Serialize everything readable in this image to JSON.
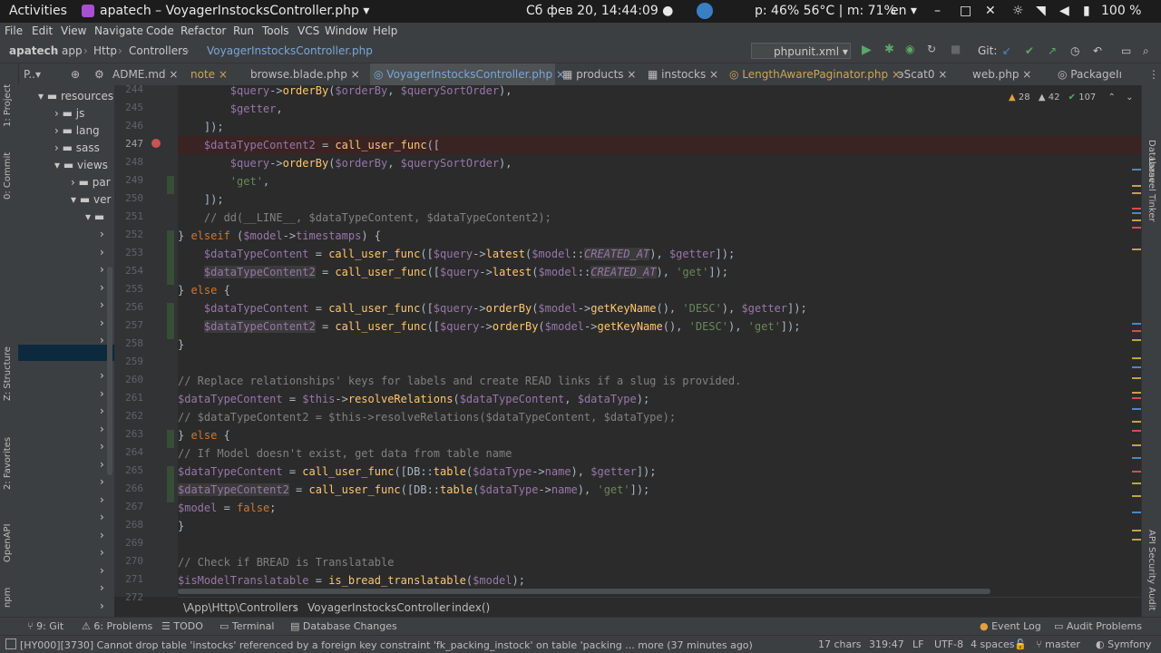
{
  "system_bar": {
    "activities": "Activities",
    "app_title": "apatech – VoyagerInstocksController.php ▾",
    "clock": "Сб фев 20, 14:44:09 ●",
    "cpu": "p: 46% 56°C | m: 71%",
    "lang": "en ▾",
    "battery": "100 %"
  },
  "menu": [
    "File",
    "Edit",
    "View",
    "Navigate",
    "Code",
    "Refactor",
    "Run",
    "Tools",
    "VCS",
    "Window",
    "Help"
  ],
  "nav": {
    "crumbs": [
      "apatech",
      "app",
      "Http",
      "Controllers",
      "VoyagerInstocksController.php"
    ],
    "run_config": "phpunit.xml",
    "git_label": "Git:"
  },
  "tabs": [
    {
      "label": "ADME.md"
    },
    {
      "label": "note"
    },
    {
      "label": "browse.blade.php"
    },
    {
      "label": "VoyagerInstocksController.php"
    },
    {
      "label": "products"
    },
    {
      "label": "instocks"
    },
    {
      "label": "LengthAwarePaginator.php"
    },
    {
      "label": "эScat0"
    },
    {
      "label": "web.php"
    },
    {
      "label": "PackageIı"
    }
  ],
  "tool_strip_left": [
    "1: Project",
    "0: Commit",
    "Z: Structure",
    "2: Favorites",
    "OpenAPI",
    "npm"
  ],
  "tool_strip_right": [
    "Database",
    "Laravel Tinker",
    "API Security Audit"
  ],
  "tree": {
    "header": "P..▾",
    "nodes": [
      "resources",
      "js",
      "lang",
      "sass",
      "views",
      "par",
      "ver"
    ]
  },
  "inspections": {
    "errors": "28",
    "warnings": "42",
    "weak": "107"
  },
  "line_numbers": [
    "244",
    "245",
    "246",
    "247",
    "248",
    "249",
    "250",
    "251",
    "252",
    "253",
    "254",
    "255",
    "256",
    "257",
    "258",
    "259",
    "260",
    "261",
    "262",
    "263",
    "264",
    "265",
    "266",
    "267",
    "268",
    "269",
    "270",
    "271",
    "272"
  ],
  "editor_breadcrumb": [
    "\\App\\Http\\Controllers",
    "VoyagerInstocksController",
    "index()"
  ],
  "bottom_tools": [
    "9: Git",
    "6: Problems",
    "TODO",
    "Terminal",
    "Database Changes",
    "Event Log",
    "Audit Problems"
  ],
  "status": {
    "message": "[HY000][3730] Cannot drop table 'instocks' referenced by a foreign key constraint 'fk_packing_instock' on table 'packing ... more (37 minutes ago)",
    "chars": "17 chars",
    "position": "319:47",
    "line_sep": "LF",
    "encoding": "UTF-8",
    "indent": "4 spaces",
    "branch": "master",
    "framework": "Symfony"
  },
  "colors": {
    "accent": "#4a88c7",
    "variable": "#9876aa",
    "function": "#ffc66d",
    "keyword": "#cc7832",
    "string": "#6a8759",
    "comment": "#808080"
  }
}
